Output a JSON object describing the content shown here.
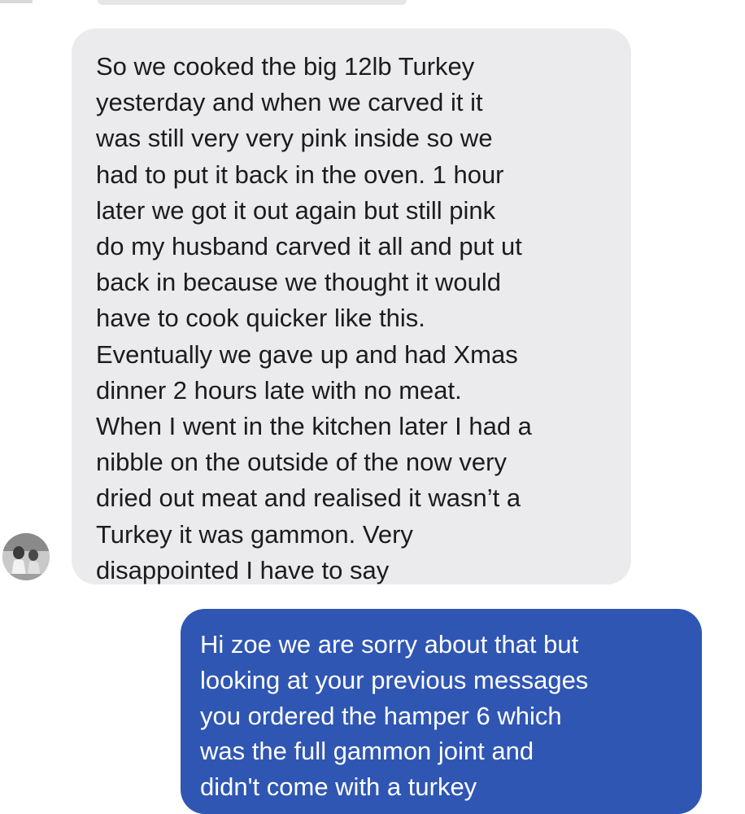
{
  "thread": {
    "incoming_message": {
      "sender_avatar_icon": "profile-photo-avatar",
      "text": "So we cooked the big 12lb Turkey\nyesterday and when we carved it it\nwas still very very pink inside so we\nhad to put it back in the oven. 1 hour\nlater we got it out again but still pink\ndo my husband carved it all and put ut\nback in because we thought it would\nhave to cook quicker like this.\nEventually we gave up and had Xmas\ndinner 2 hours late with no meat.\nWhen I went in the kitchen later I had a\nnibble on the outside of the now very\ndried out meat and realised it wasn’t a\nTurkey it was gammon. Very\ndisappointed I have to say"
    },
    "outgoing_message": {
      "text": "Hi zoe we are sorry about that but\nlooking at your previous messages\nyou ordered the hamper 6 which\nwas the full gammon joint and\ndidn't come with a turkey"
    }
  },
  "colors": {
    "page_background": "#ffffff",
    "incoming_bubble": "#ebebee",
    "incoming_text": "#1c1c1e",
    "outgoing_bubble": "#2f56b3",
    "outgoing_text": "#ffffff"
  }
}
